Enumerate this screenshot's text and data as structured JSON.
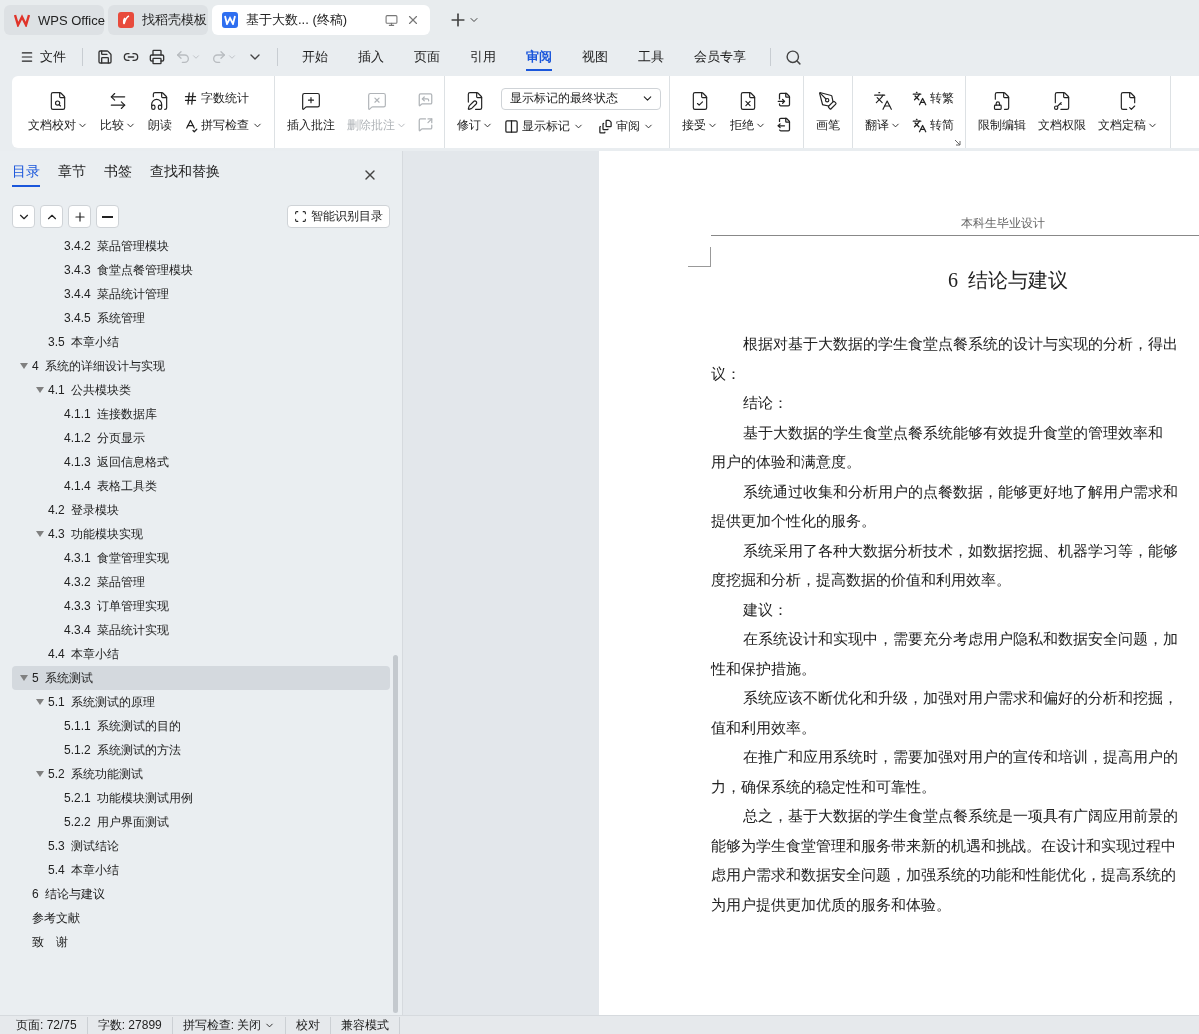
{
  "app_tabs": [
    {
      "kind": "home",
      "label": "WPS Office",
      "selected": false
    },
    {
      "kind": "template",
      "label": "找稻壳模板",
      "selected": false
    },
    {
      "kind": "document",
      "label": "基于大数... (终稿)",
      "selected": true
    }
  ],
  "menu": {
    "file_label": "文件",
    "quick_access": [
      {
        "disabled": false
      },
      {
        "disabled": false
      },
      {
        "disabled": false
      },
      {
        "disabled": true
      },
      {
        "disabled": true
      }
    ],
    "tabs": [
      {
        "label": "开始",
        "selected": false
      },
      {
        "label": "插入",
        "selected": false
      },
      {
        "label": "页面",
        "selected": false
      },
      {
        "label": "引用",
        "selected": false
      },
      {
        "label": "审阅",
        "selected": true
      },
      {
        "label": "视图",
        "selected": false
      },
      {
        "label": "工具",
        "selected": false
      },
      {
        "label": "会员专享",
        "selected": false
      }
    ]
  },
  "ribbon": {
    "groups": [
      {
        "items": [
          {
            "kind": "large",
            "label": "文档校对",
            "dropdown": true,
            "disabled": false
          },
          {
            "kind": "large",
            "label": "比较",
            "dropdown": true,
            "disabled": false
          },
          {
            "kind": "large",
            "label": "朗读",
            "dropdown": false,
            "disabled": false
          },
          {
            "kind": "stack",
            "buttons": [
              {
                "label": "字数统计",
                "dropdown": false,
                "disabled": false
              },
              {
                "label": "拼写检查",
                "dropdown": true,
                "disabled": false
              }
            ]
          }
        ]
      },
      {
        "items": [
          {
            "kind": "large",
            "label": "插入批注",
            "dropdown": false,
            "disabled": false
          },
          {
            "kind": "large",
            "label": "删除批注",
            "dropdown": true,
            "disabled": true
          },
          {
            "kind": "stack",
            "buttons": [
              {
                "dropdown": false,
                "disabled": true
              },
              {
                "dropdown": false,
                "disabled": true
              }
            ]
          }
        ]
      },
      {
        "items": [
          {
            "kind": "large",
            "label": "修订",
            "dropdown": true,
            "disabled": false
          },
          {
            "kind": "select",
            "value": "显示标记的最终状态",
            "buttons": [
              {
                "label": "显示标记",
                "dropdown": true,
                "disabled": false
              },
              {
                "label": "审阅",
                "dropdown": true,
                "disabled": false
              }
            ]
          }
        ]
      },
      {
        "items": [
          {
            "kind": "large",
            "label": "接受",
            "dropdown": true,
            "disabled": false
          },
          {
            "kind": "large",
            "label": "拒绝",
            "dropdown": true,
            "disabled": false
          },
          {
            "kind": "stack",
            "buttons": [
              {
                "dropdown": false,
                "disabled": false
              },
              {
                "dropdown": false,
                "disabled": false
              }
            ]
          }
        ]
      },
      {
        "items": [
          {
            "kind": "large",
            "label": "画笔",
            "dropdown": false,
            "disabled": false
          }
        ]
      },
      {
        "launcher": true,
        "items": [
          {
            "kind": "large",
            "label": "翻译",
            "dropdown": true,
            "disabled": false
          },
          {
            "kind": "stack",
            "buttons": [
              {
                "label": "转繁",
                "dropdown": false,
                "disabled": false
              },
              {
                "label": "转简",
                "dropdown": false,
                "disabled": false
              }
            ]
          }
        ]
      },
      {
        "items": [
          {
            "kind": "large",
            "label": "限制编辑",
            "dropdown": false,
            "disabled": false
          },
          {
            "kind": "large",
            "label": "文档权限",
            "dropdown": false,
            "disabled": false
          },
          {
            "kind": "large",
            "label": "文档定稿",
            "dropdown": true,
            "disabled": false
          }
        ]
      }
    ]
  },
  "nav_panel": {
    "tabs": [
      {
        "label": "目录",
        "selected": true
      },
      {
        "label": "章节",
        "selected": false
      },
      {
        "label": "书签",
        "selected": false
      },
      {
        "label": "查找和替换",
        "selected": false
      }
    ],
    "smart_button": "智能识别目录",
    "tree": [
      {
        "children": [
          {
            "children": [
              {
                "label": "3.4.2  菜品管理模块",
                "selected": false
              },
              {
                "label": "3.4.3  食堂点餐管理模块",
                "selected": false
              },
              {
                "label": "3.4.4  菜品统计管理",
                "selected": false
              },
              {
                "label": "3.4.5  系统管理",
                "selected": false
              }
            ]
          },
          {
            "label": "3.5  本章小结",
            "selected": false
          }
        ]
      },
      {
        "label": "4  系统的详细设计与实现",
        "selected": false,
        "expanded": true,
        "children": [
          {
            "label": "4.1  公共模块类",
            "selected": false,
            "expanded": true,
            "children": [
              {
                "label": "4.1.1  连接数据库",
                "selected": false
              },
              {
                "label": "4.1.2  分页显示",
                "selected": false
              },
              {
                "label": "4.1.3  返回信息格式",
                "selected": false
              },
              {
                "label": "4.1.4  表格工具类",
                "selected": false
              }
            ]
          },
          {
            "label": "4.2  登录模块",
            "selected": false
          },
          {
            "label": "4.3  功能模块实现",
            "selected": false,
            "expanded": true,
            "children": [
              {
                "label": "4.3.1  食堂管理实现",
                "selected": false
              },
              {
                "label": "4.3.2  菜品管理",
                "selected": false
              },
              {
                "label": "4.3.3  订单管理实现",
                "selected": false
              },
              {
                "label": "4.3.4  菜品统计实现",
                "selected": false
              }
            ]
          },
          {
            "label": "4.4  本章小结",
            "selected": false
          }
        ]
      },
      {
        "label": "5  系统测试",
        "selected": true,
        "expanded": true,
        "children": [
          {
            "label": "5.1  系统测试的原理",
            "selected": false,
            "expanded": true,
            "children": [
              {
                "label": "5.1.1  系统测试的目的",
                "selected": false
              },
              {
                "label": "5.1.2  系统测试的方法",
                "selected": false
              }
            ]
          },
          {
            "label": "5.2  系统功能测试",
            "selected": false,
            "expanded": true,
            "children": [
              {
                "label": "5.2.1  功能模块测试用例",
                "selected": false
              },
              {
                "label": "5.2.2  用户界面测试",
                "selected": false
              }
            ]
          },
          {
            "label": "5.3  测试结论",
            "selected": false
          },
          {
            "label": "5.4  本章小结",
            "selected": false
          }
        ]
      },
      {
        "label": "6  结论与建议",
        "selected": false
      },
      {
        "label": "参考文献",
        "selected": false
      },
      {
        "label": "致　谢",
        "selected": false
      }
    ]
  },
  "document": {
    "header": "本科生毕业设计",
    "title": "6  结论与建议",
    "lines": [
      {
        "text": "根据对基于大数据的学生食堂点餐系统的设计与实现的分析，得出",
        "indent": true
      },
      {
        "text": "议：",
        "indent": false
      },
      {
        "text": "结论：",
        "indent": true
      },
      {
        "text": "基于大数据的学生食堂点餐系统能够有效提升食堂的管理效率和",
        "indent": true
      },
      {
        "text": "用户的体验和满意度。",
        "indent": false
      },
      {
        "text": "系统通过收集和分析用户的点餐数据，能够更好地了解用户需求和",
        "indent": true
      },
      {
        "text": "提供更加个性化的服务。",
        "indent": false
      },
      {
        "text": "系统采用了各种大数据分析技术，如数据挖掘、机器学习等，能够",
        "indent": true
      },
      {
        "text": "度挖掘和分析，提高数据的价值和利用效率。",
        "indent": false
      },
      {
        "text": "建议：",
        "indent": true
      },
      {
        "text": "在系统设计和实现中，需要充分考虑用户隐私和数据安全问题，加",
        "indent": true
      },
      {
        "text": "性和保护措施。",
        "indent": false
      },
      {
        "text": "系统应该不断优化和升级，加强对用户需求和偏好的分析和挖掘，",
        "indent": true
      },
      {
        "text": "值和利用效率。",
        "indent": false
      },
      {
        "text": "在推广和应用系统时，需要加强对用户的宣传和培训，提高用户的",
        "indent": true
      },
      {
        "text": "力，确保系统的稳定性和可靠性。",
        "indent": false
      },
      {
        "text": "总之，基于大数据的学生食堂点餐系统是一项具有广阔应用前景的",
        "indent": true
      },
      {
        "text": "能够为学生食堂管理和服务带来新的机遇和挑战。在设计和实现过程中",
        "indent": false
      },
      {
        "text": "虑用户需求和数据安全问题，加强系统的功能和性能优化，提高系统的",
        "indent": false
      },
      {
        "text": "为用户提供更加优质的服务和体验。",
        "indent": false
      }
    ]
  },
  "status_bar": [
    {
      "kind": "text",
      "label": "页面: 72/75"
    },
    {
      "kind": "text",
      "label": "字数: 27899"
    },
    {
      "kind": "dropdown",
      "label": "拼写检查: 关闭"
    },
    {
      "kind": "button",
      "label": "校对"
    },
    {
      "kind": "button",
      "label": "兼容模式"
    }
  ]
}
